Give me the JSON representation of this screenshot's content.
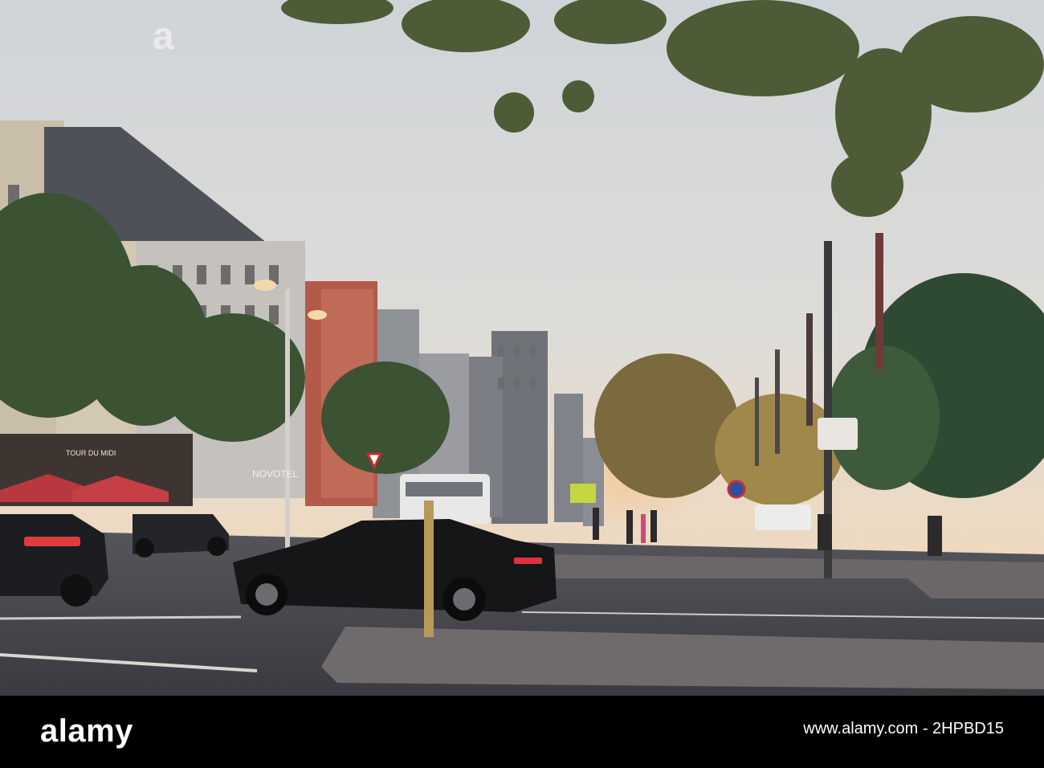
{
  "photo": {
    "signage": {
      "hotel_brand": "NOVOTEL",
      "restaurant_sign": "TOUR DU MIDI"
    }
  },
  "footer": {
    "brand_logo": "alamy",
    "image_id": "www.alamy.com - 2HPBD15"
  },
  "watermarks": {
    "logo": "a"
  },
  "colors": {
    "sky_top": "#cfd3d6",
    "sky_bottom": "#e9dcc9",
    "road": "#4a4c52",
    "car_body": "#141618",
    "foliage": "#3f5a36",
    "brand_bar": "#000000"
  }
}
